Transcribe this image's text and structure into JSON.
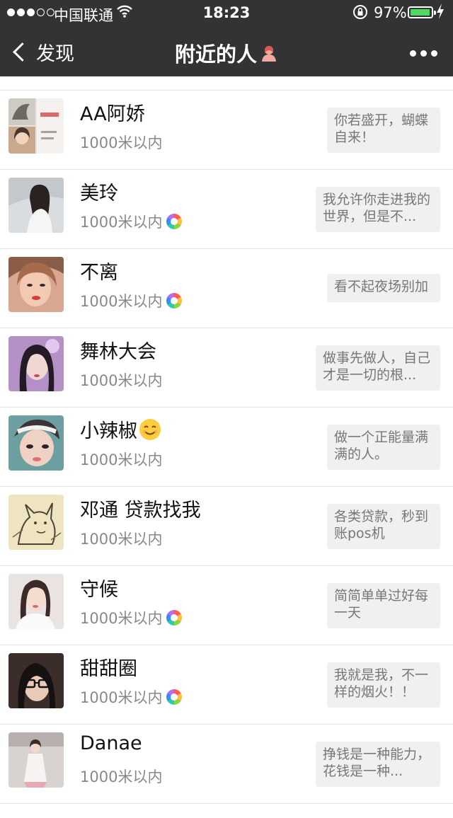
{
  "status_bar": {
    "carrier": "中国联通",
    "time": "18:23",
    "battery_percent": "97%",
    "battery_level": 0.97,
    "icons": [
      "signal-dots-icon",
      "wifi-icon",
      "orientation-lock-icon",
      "battery-icon",
      "charging-bolt-icon"
    ]
  },
  "nav": {
    "back_label": "发现",
    "title": "附近的人",
    "icons": [
      "back-chevron-icon",
      "female-icon",
      "more-icon"
    ]
  },
  "people": [
    {
      "name": "AA阿娇",
      "distance": "1000米以内",
      "signature": "你若盛开，蝴蝶自来！",
      "has_moments": false
    },
    {
      "name": "美玲",
      "distance": "1000米以内",
      "signature": "我允许你走进我的世界，但是不...",
      "has_moments": true
    },
    {
      "name": "不离",
      "distance": "1000米以内",
      "signature": "看不起夜场别加",
      "has_moments": true
    },
    {
      "name": "舞林大会",
      "distance": "1000米以内",
      "signature": "做事先做人，自己才是一切的根...",
      "has_moments": false
    },
    {
      "name": "小辣椒",
      "distance": "1000米以内",
      "signature": "做一个正能量满满的人。",
      "has_moments": false,
      "emoji": "smile-emoji-icon"
    },
    {
      "name": "邓通 贷款找我",
      "distance": "1000米以内",
      "signature": "各类贷款，秒到账pos机",
      "has_moments": false
    },
    {
      "name": "守候",
      "distance": "1000米以内",
      "signature": "简简单单过好每一天",
      "has_moments": true
    },
    {
      "name": "甜甜圈",
      "distance": "1000米以内",
      "signature": "我就是我，不一样的烟火！！",
      "has_moments": true
    },
    {
      "name": "Danae",
      "distance": "1000米以内",
      "signature": "挣钱是一种能力，花钱是一种...",
      "has_moments": false
    }
  ],
  "colors": {
    "bar": "#333336",
    "battery": "#4cd964",
    "signature_bg": "#f0f0f0"
  }
}
